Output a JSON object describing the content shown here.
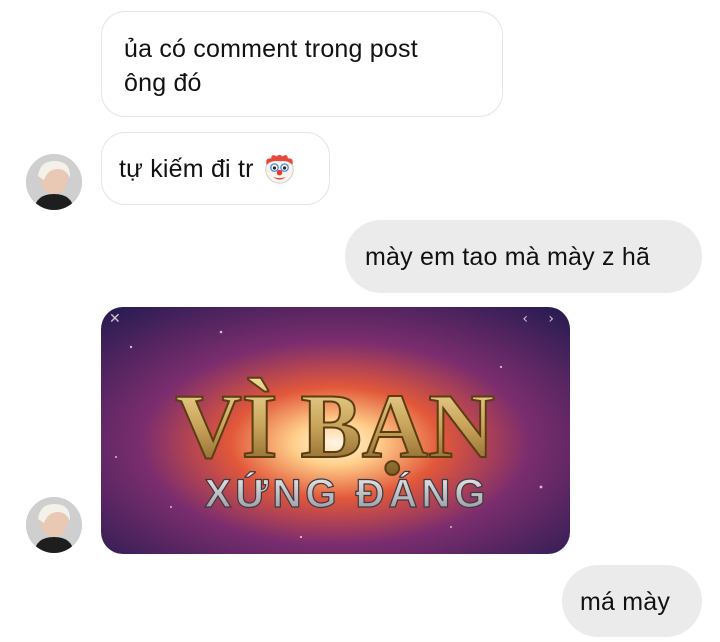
{
  "messages": [
    {
      "direction": "received",
      "lines": [
        "ủa có comment trong post",
        "ông đó"
      ]
    },
    {
      "direction": "received",
      "text": "tự kiếm đi tr",
      "emoji": "clown-face-icon"
    },
    {
      "direction": "sent",
      "text": "mày em tao mà mày z hã"
    },
    {
      "direction": "received",
      "type": "image",
      "image_text": {
        "line1": "VÌ BẠN",
        "line2": "XỨNG ĐÁNG"
      }
    },
    {
      "direction": "sent",
      "text": "má mày"
    }
  ],
  "avatar_icon": "user-avatar-photo",
  "colors": {
    "sent_bubble": "#ebebeb",
    "received_border": "#e4e4e4",
    "text": "#111111",
    "image_gold": "#c9a45a"
  }
}
